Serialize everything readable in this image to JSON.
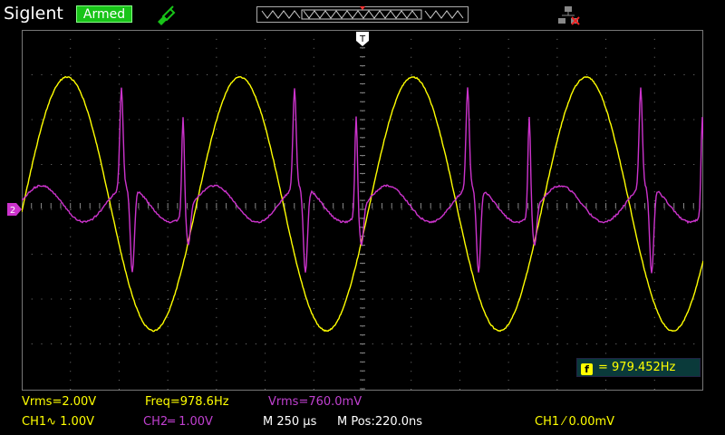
{
  "brand": "Siglent",
  "status": "Armed",
  "icons": {
    "probe": "probe-icon",
    "network": "network-icon",
    "trigger": "trigger-arrow-icon"
  },
  "colors": {
    "ch1": "#ffff00",
    "ch2": "#cc33cc",
    "armed": "#18c418",
    "grid": "#606060"
  },
  "freq_counter": {
    "label": "f",
    "value": "= 979.452Hz"
  },
  "measurements": {
    "ch1_vrms": "Vrms=2.00V",
    "ch1_freq": "Freq=978.6Hz",
    "ch2_vrms": "Vrms=760.0mV"
  },
  "channels": {
    "ch1": "CH1∿ 1.00V",
    "ch2": "CH2═ 1.00V"
  },
  "timebase": "M 250 µs",
  "mpos": "M Pos:220.0ns",
  "trigger": "CH1 ⁄ 0.00mV",
  "markers": {
    "ch2": "2",
    "trigger_top": "T"
  },
  "waveform": {
    "ch1": {
      "frequency_hz": 978.6,
      "amplitude_div": 2.8
    },
    "ch2": {
      "frequency_hz": 978.6
    }
  },
  "grid": {
    "h_div": 14,
    "v_div": 8
  }
}
